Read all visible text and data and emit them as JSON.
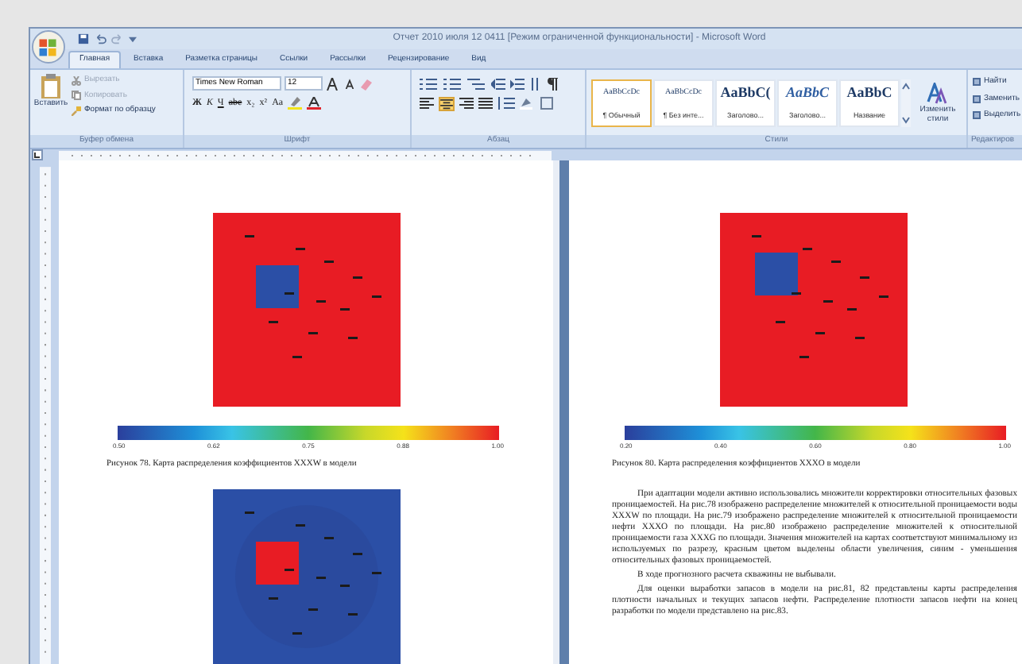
{
  "window": {
    "title": "Отчет 2010 июля 12 0411 [Режим ограниченной функциональности] - Microsoft Word"
  },
  "tabs": [
    {
      "label": "Главная",
      "selected": true
    },
    {
      "label": "Вставка",
      "selected": false
    },
    {
      "label": "Разметка страницы",
      "selected": false
    },
    {
      "label": "Ссылки",
      "selected": false
    },
    {
      "label": "Рассылки",
      "selected": false
    },
    {
      "label": "Рецензирование",
      "selected": false
    },
    {
      "label": "Вид",
      "selected": false
    }
  ],
  "ribbon": {
    "clipboard": {
      "paste": "Вставить",
      "items": [
        {
          "label": "Вырезать",
          "disabled": true
        },
        {
          "label": "Копировать",
          "disabled": true
        },
        {
          "label": "Формат по образцу",
          "disabled": false
        }
      ],
      "group_label": "Буфер обмена"
    },
    "font": {
      "font_name": "Times New Roman",
      "font_size": "12",
      "format_buttons": [
        "Ж",
        "К",
        "Ч",
        "abe",
        "x₂",
        "x²",
        "Aa"
      ],
      "group_label": "Шрифт"
    },
    "paragraph": {
      "group_label": "Абзац"
    },
    "styles": {
      "items": [
        {
          "preview": "AaBbCcDc",
          "name": "¶ Обычный",
          "selected": true
        },
        {
          "preview": "AaBbCcDc",
          "name": "¶ Без инте...",
          "selected": false
        },
        {
          "preview": "AaBbC(",
          "name": "Заголово...",
          "selected": false
        },
        {
          "preview": "AaBbC",
          "name": "Заголово...",
          "selected": false
        },
        {
          "preview": "AaBbC",
          "name": "Название",
          "selected": false
        }
      ],
      "change_styles": "Изменить стили",
      "group_label": "Стили"
    },
    "editing": {
      "items": [
        "Найти",
        "Заменить",
        "Выделить"
      ],
      "group_label": "Редактиров"
    }
  },
  "pages": [
    {
      "blocks": [
        {
          "kind": "picture"
        },
        {
          "kind": "colorbar",
          "ticks": [
            "0.50",
            "0.62",
            "0.75",
            "0.88",
            "1.00"
          ]
        },
        {
          "kind": "caption",
          "text": "Рисунок 78. Карта распределения коэффициентов XXXW в модели"
        },
        {
          "kind": "picture"
        }
      ]
    },
    {
      "blocks": [
        {
          "kind": "picture"
        },
        {
          "kind": "colorbar",
          "ticks": [
            "0.20",
            "0.40",
            "0.60",
            "0.80",
            "1.00"
          ]
        },
        {
          "kind": "caption",
          "text": "Рисунок 80. Карта распределения коэффициентов XXXO в модели"
        },
        {
          "kind": "paragraph",
          "text": "При адаптации модели активно использовались множители корректировки относительных фазовых проницаемостей. На рис.78 изображено распределение множителей к относительной проницаемости воды XXXW по площади. На рис.79 изображено распределение множителей к относительной проницаемости нефти XXXO по площади. На рис.80 изображено распределение множителей к относительной проницаемости газа XXXG по площади. Значения множителей на картах соответствуют минимальному из используемых по разрезу, красным цветом выделены области увеличения, синим - уменьшения относительных фазовых проницаемостей."
        },
        {
          "kind": "paragraph",
          "text": "В ходе прогнозного расчета скважины не выбывали."
        },
        {
          "kind": "paragraph",
          "text": "Для оценки выработки запасов в модели на рис.81, 82 представлены карты распределения плотности начальных и текущих запасов нефти. Распределение плотности запасов нефти на конец разработки по модели представлено на рис.83."
        }
      ]
    }
  ]
}
